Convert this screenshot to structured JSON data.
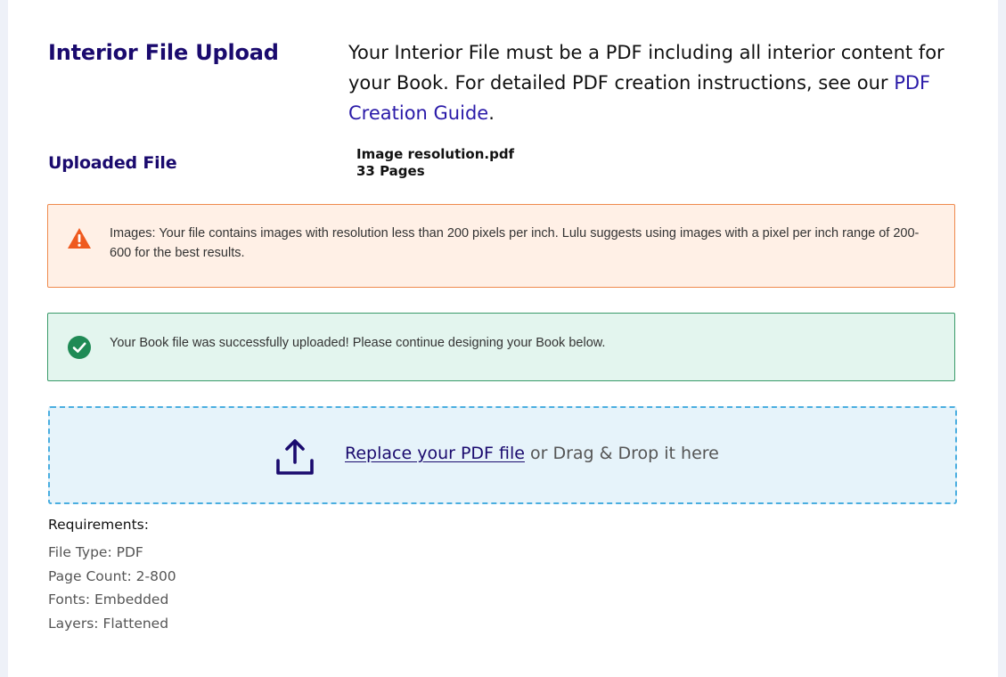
{
  "section": {
    "title": "Interior File Upload",
    "intro_text": "Your Interior File must be a PDF including all interior content for your Book. For detailed PDF creation instructions, see our ",
    "guide_link": "PDF Creation Guide",
    "intro_end": "."
  },
  "uploaded": {
    "label": "Uploaded File",
    "file_name": "Image resolution.pdf",
    "page_count": "33 Pages"
  },
  "warning": {
    "icon": "warning-triangle-icon",
    "color": "#ef5a1f",
    "text": "Images: Your file contains images with resolution less than 200 pixels per inch. Lulu suggests using images with a pixel per inch range of 200-600 for the best results."
  },
  "success": {
    "icon": "check-circle-icon",
    "color": "#1f8a55",
    "text": "Your Book file was successfully uploaded! Please continue designing your Book below."
  },
  "dropzone": {
    "icon": "upload-icon",
    "link": "Replace your PDF file",
    "text": " or Drag & Drop it here"
  },
  "requirements": {
    "title": "Requirements:",
    "items": [
      "File Type: PDF",
      "Page Count: 2-800",
      "Fonts: Embedded",
      "Layers: Flattened"
    ]
  },
  "colors": {
    "heading": "#1a0a6e",
    "link": "#2a1aa8",
    "dropzone_border": "#4aaee0",
    "dropzone_bg": "#e6f3fa"
  }
}
